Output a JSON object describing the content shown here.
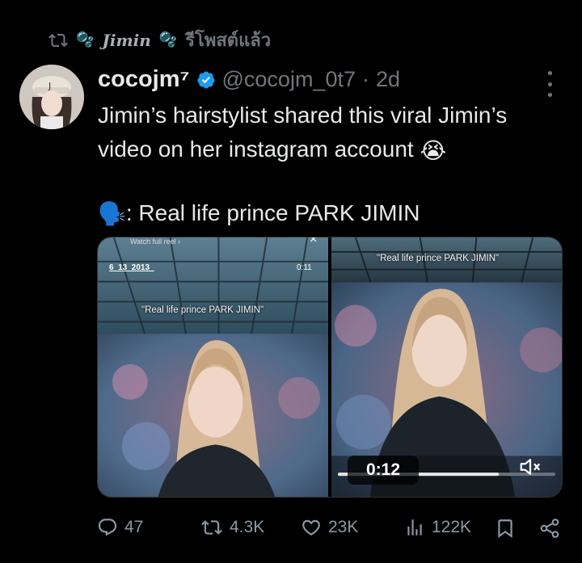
{
  "repost": {
    "icon": "repost-icon",
    "reposter_name": "Jimin",
    "reposter_emoji": "🫧",
    "label": "รีโพสต์แล้ว"
  },
  "tweet": {
    "avatar": "user-avatar",
    "display_name": "cocojm⁷",
    "verified": true,
    "handle": "@cocojm_0t7",
    "separator": "·",
    "time": "2d",
    "text_line1": "Jimin’s hairstylist shared this viral Jimin’s",
    "text_line2": "video on her instagram account",
    "text_line2_emoji": "😭",
    "text_line3_emoji": "🗣️",
    "text_line3": ": Real life prince PARK JIMIN"
  },
  "media": {
    "left": {
      "watch_label": "Watch full reel ›",
      "date_tag": "6_13_2013_",
      "video_time": "0:11",
      "caption": "\"Real life prince PARK JIMIN\""
    },
    "right": {
      "caption": "\"Real life prince PARK JIMIN\"",
      "duration": "0:12",
      "mute_icon": "mute-icon"
    }
  },
  "actions": {
    "replies": "47",
    "reposts": "4.3K",
    "likes": "23K",
    "views": "122K"
  },
  "colors": {
    "background": "#000000",
    "text": "#e7e9ea",
    "muted": "#71767b",
    "action": "#8b98a5",
    "verified": "#1d9bf0"
  }
}
